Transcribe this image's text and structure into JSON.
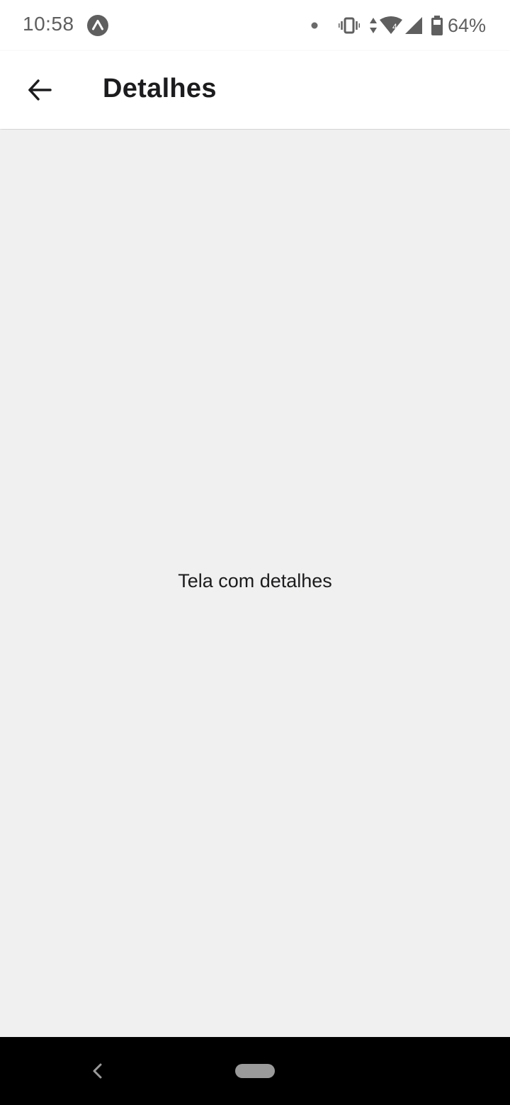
{
  "status_bar": {
    "time": "10:58",
    "battery_percent": "64%",
    "app_notification_icon": "expo-icon",
    "icons": [
      "dot-icon",
      "vibrate-icon",
      "data-arrows-icon",
      "wifi-icon",
      "cell-signal-icon",
      "battery-icon"
    ],
    "network_label": "4"
  },
  "app_bar": {
    "back_icon": "arrow-left-icon",
    "title": "Detalhes"
  },
  "content": {
    "message": "Tela com detalhes"
  },
  "nav_bar": {
    "back_icon": "chevron-left-icon",
    "home_icon": "home-pill-icon"
  },
  "colors": {
    "background": "#f0f0f0",
    "app_bar": "#ffffff",
    "nav_bar": "#000000",
    "status_text": "#5f5f5f",
    "title_text": "#1c1c1e"
  }
}
